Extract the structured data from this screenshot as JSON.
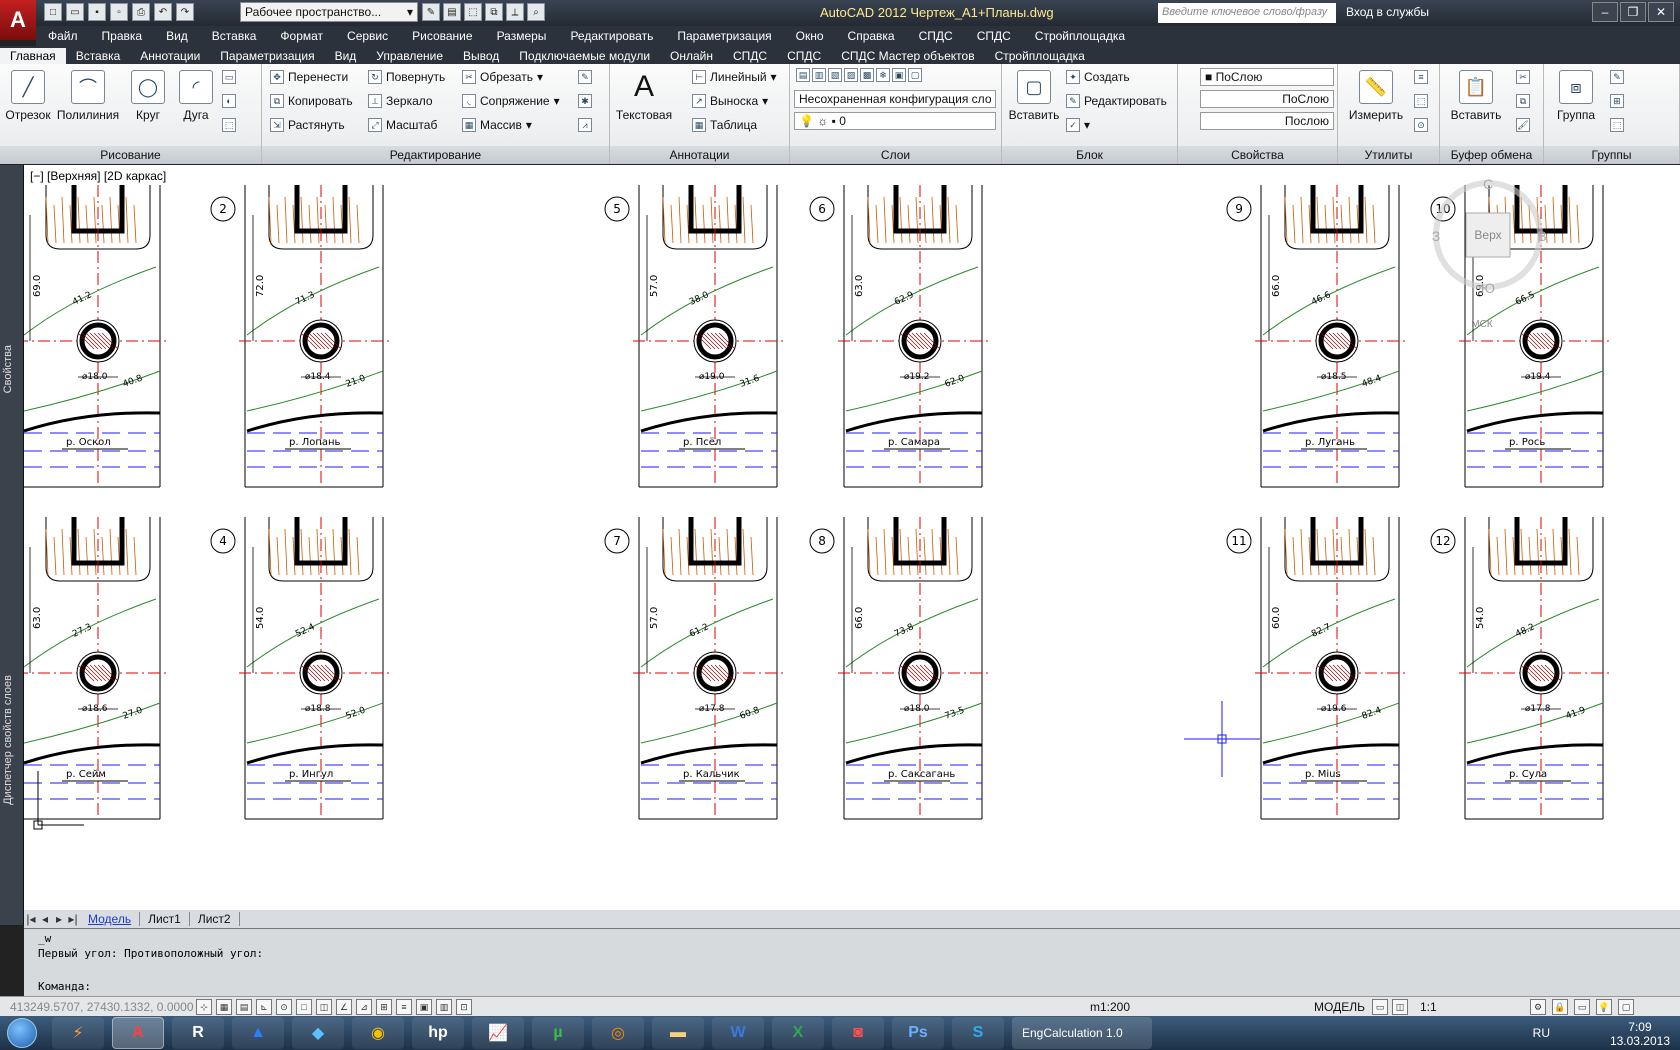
{
  "app": {
    "title": "AutoCAD 2012    Чертеж_A1+Планы.dwg",
    "logo": "A",
    "workspace": "Рабочее пространство...",
    "search_placeholder": "Введите ключевое слово/фразу",
    "login": "Вход в службы"
  },
  "menu": [
    "Файл",
    "Правка",
    "Вид",
    "Вставка",
    "Формат",
    "Сервис",
    "Рисование",
    "Размеры",
    "Редактировать",
    "Параметризация",
    "Окно",
    "Справка",
    "СПДС",
    "СПДС",
    "Стройплощадка"
  ],
  "ribbon_tabs": [
    "Главная",
    "Вставка",
    "Аннотации",
    "Параметризация",
    "Вид",
    "Управление",
    "Вывод",
    "Подключаемые модули",
    "Онлайн",
    "СПДС",
    "СПДС",
    "СПДС Мастер объектов",
    "Стройплощадка"
  ],
  "panels": {
    "draw": {
      "title": "Рисование",
      "line": "Отрезок",
      "polyline": "Полилиния",
      "circle": "Круг",
      "arc": "Дуга"
    },
    "modify": {
      "title": "Редактирование",
      "move": "Перенести",
      "rotate": "Повернуть",
      "trim": "Обрезать",
      "copy": "Копировать",
      "mirror": "Зеркало",
      "fillet": "Сопряжение",
      "stretch": "Растянуть",
      "scale": "Масштаб",
      "array": "Массив"
    },
    "annotation": {
      "title": "Аннотации",
      "text": "Текстовая",
      "linear": "Линейный",
      "leader": "Выноска",
      "table": "Таблица"
    },
    "layers": {
      "title": "Слои",
      "config": "Несохраненная конфигурация сло",
      "layer": "0"
    },
    "block": {
      "title": "Блок",
      "insert": "Вставить",
      "create": "Создать",
      "edit": "Редактировать"
    },
    "properties": {
      "title": "Свойства",
      "color": "ПоСлою",
      "linetype": "ПоСлою",
      "lineweight": "Послою"
    },
    "utilities": {
      "title": "Утилиты",
      "measure": "Измерить"
    },
    "clipboard": {
      "title": "Буфер обмена",
      "paste": "Вставить"
    },
    "groups": {
      "title": "Группы",
      "group": "Группа"
    }
  },
  "viewport": {
    "label": "[−] [Верхняя] [2D каркас]",
    "viewcube": {
      "top": "Верх",
      "north": "С",
      "south": "Ю",
      "west": "З",
      "east": "В",
      "ucs": "МСК"
    }
  },
  "sheets": [
    {
      "num": "",
      "dim": "69.0",
      "d": "⌀18.0",
      "t1": "41.2",
      "t2": "40.8",
      "river": "р. Оскол"
    },
    {
      "num": "2",
      "dim": "72.0",
      "d": "⌀18.4",
      "t1": "71.3",
      "t2": "21.0",
      "river": "р. Лопань"
    },
    {
      "num": "5",
      "dim": "57.0",
      "d": "⌀19.0",
      "t1": "38.0",
      "t2": "31.6",
      "river": "р. Псёл"
    },
    {
      "num": "6",
      "dim": "63.0",
      "d": "⌀19.2",
      "t1": "62.9",
      "t2": "62.0",
      "river": "р. Самара"
    },
    {
      "num": "9",
      "dim": "66.0",
      "d": "⌀18.5",
      "t1": "46.6",
      "t2": "48.4",
      "river": "р. Лугань"
    },
    {
      "num": "10",
      "dim": "69.0",
      "d": "⌀19.4",
      "t1": "66.5",
      "t2": "",
      "river": "р. Рось"
    },
    {
      "num": "",
      "dim": "63.0",
      "d": "⌀18.6",
      "t1": "27.3",
      "t2": "27.0",
      "river": "р. Сейм"
    },
    {
      "num": "4",
      "dim": "54.0",
      "d": "⌀18.8",
      "t1": "52.4",
      "t2": "52.0",
      "river": "р. Ингул"
    },
    {
      "num": "7",
      "dim": "57.0",
      "d": "⌀17.8",
      "t1": "61.2",
      "t2": "60.8",
      "river": "р. Кальчик"
    },
    {
      "num": "8",
      "dim": "66.0",
      "d": "⌀18.0",
      "t1": "73.8",
      "t2": "73.5",
      "river": "р. Саксагань"
    },
    {
      "num": "11",
      "dim": "60.0",
      "d": "⌀19.6",
      "t1": "82.7",
      "t2": "82.4",
      "river": "р. Мius"
    },
    {
      "num": "12",
      "dim": "54.0",
      "d": "⌀17.8",
      "t1": "48.2",
      "t2": "41.9",
      "river": "р. Сула"
    }
  ],
  "layout_tabs": [
    "Модель",
    "Лист1",
    "Лист2"
  ],
  "command": {
    "line1": "_w",
    "line2": "Первый угол: Противоположный угол:",
    "prompt": "Команда:"
  },
  "status": {
    "coords": "413249.5707, 27430.1332, 0.0000",
    "scale": "m1:200",
    "space": "МОДЕЛЬ",
    "anno_scale": "1:1"
  },
  "taskbar": {
    "active_window": "EngCalculation 1.0",
    "lang": "RU",
    "time": "7:09",
    "date": "13.03.2013"
  },
  "side_palettes": [
    "Свойства",
    "Диспетчер свойств слоев"
  ],
  "colors": {
    "accent": "#c42020",
    "red_axis": "#e00000",
    "green_contour": "#2a8a2a",
    "blue_water": "#1a1aff",
    "hatch": "#c85a00"
  }
}
